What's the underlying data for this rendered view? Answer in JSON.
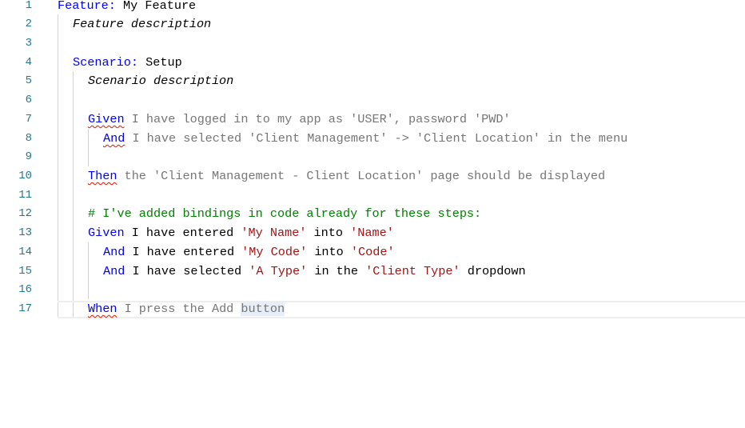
{
  "line_numbers": [
    "1",
    "2",
    "3",
    "4",
    "5",
    "6",
    "7",
    "8",
    "9",
    "10",
    "11",
    "12",
    "13",
    "14",
    "15",
    "16",
    "17"
  ],
  "lines": {
    "l1": {
      "kw": "Feature:",
      "text": " My Feature"
    },
    "l2": {
      "text": "Feature description"
    },
    "l4": {
      "kw": "Scenario:",
      "text": " Setup"
    },
    "l5": {
      "text": "Scenario description"
    },
    "l7": {
      "kw": "Given",
      "text": " I have logged in to my app as 'USER', password 'PWD'"
    },
    "l8": {
      "kw": "And",
      "text": " I have selected 'Client Management' -> 'Client Location' in the menu"
    },
    "l10": {
      "kw": "Then",
      "text": " the 'Client Management - Client Location' page should be displayed"
    },
    "l12": {
      "text": "# I've added bindings in code already for these steps:"
    },
    "l13": {
      "kw": "Given",
      "t1": " I have entered ",
      "s1": "'My Name'",
      "t2": " into ",
      "s2": "'Name'"
    },
    "l14": {
      "kw": "And",
      "t1": " I have entered ",
      "s1": "'My Code'",
      "t2": " into ",
      "s2": "'Code'"
    },
    "l15": {
      "kw": "And",
      "t1": " I have selected ",
      "s1": "'A Type'",
      "t2": " in the ",
      "s2": "'Client Type'",
      "t3": " dropdown"
    },
    "l17": {
      "kw": "When",
      "t1": " I press the Add ",
      "hl": "button"
    }
  },
  "colors": {
    "keyword": "#0000ff",
    "string": "#a31515",
    "comment": "#008000",
    "unbound_step": "#767676",
    "line_number": "#237893",
    "squiggle": "#e51400"
  }
}
